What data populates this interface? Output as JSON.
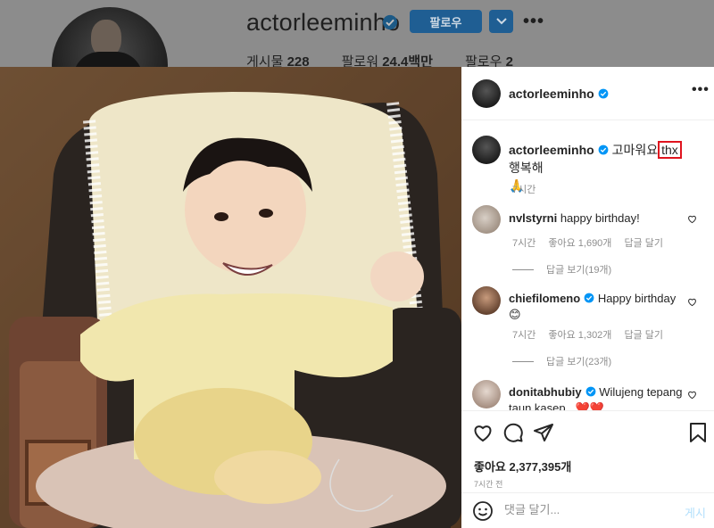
{
  "profile": {
    "username": "actorleeminho",
    "follow_label": "팔로우",
    "stats": {
      "posts_label": "게시물",
      "posts": "228",
      "followers_label": "팔로워",
      "followers": "24.4백만",
      "following_label": "팔로우",
      "following": "2"
    }
  },
  "post": {
    "author": "actorleeminho",
    "caption": {
      "username": "actorleeminho",
      "text_before": "고마워요",
      "highlight": "thx",
      "text_after": "행복해",
      "emoji": "🙏",
      "time": "7시간"
    },
    "comments": [
      {
        "username": "nvlstyrni",
        "text": "happy birthday!",
        "time": "7시간",
        "likes": "좋아요 1,690개",
        "reply": "답글 달기",
        "view_replies": "답글 보기(19개)"
      },
      {
        "username": "chiefilomeno",
        "text": "Happy birthday",
        "emoji": "😊",
        "time": "7시간",
        "likes": "좋아요 1,302개",
        "reply": "답글 달기",
        "view_replies": "답글 보기(23개)"
      },
      {
        "username": "donitabhubiy",
        "text": "Wilujeng tepang taun kasep..",
        "emoji": "❤️❤️"
      }
    ],
    "likes_text": "좋아요 2,377,395개",
    "time_ago": "7시간 전",
    "comment_placeholder": "댓글 달기...",
    "post_button": "게시"
  },
  "colors": {
    "follow_blue": "#1f5e93",
    "verified": "#0095f6",
    "highlight_box": "#e0141e"
  }
}
